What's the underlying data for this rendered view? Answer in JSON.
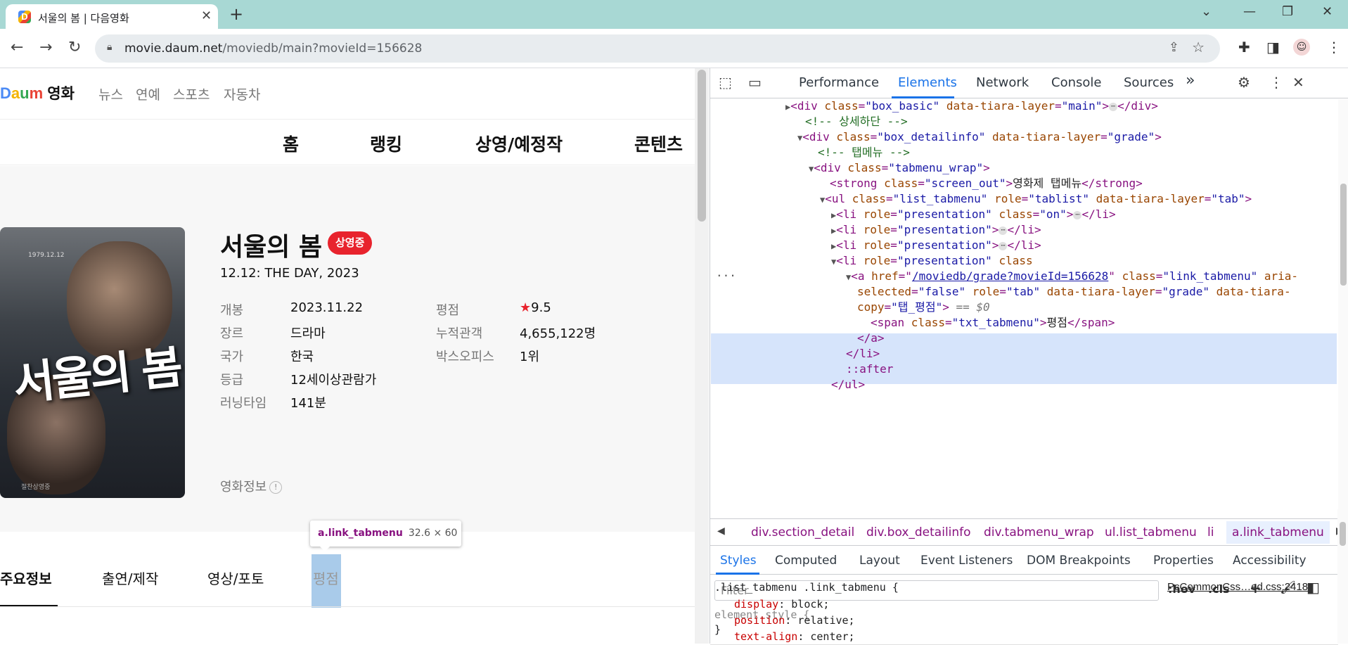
{
  "browser": {
    "tab_title": "서울의 봄 | 다음영화",
    "tab_favicon": "D",
    "url_host": "movie.daum.net",
    "url_path": "/moviedb/main?movieId=156628"
  },
  "site": {
    "logo": {
      "d": "D",
      "a": "a",
      "u": "u",
      "m": "m",
      "label": "영화"
    },
    "gnb": [
      "뉴스",
      "연예",
      "스포츠",
      "자동차"
    ],
    "lnb": [
      "홈",
      "랭킹",
      "상영/예정작",
      "콘텐츠"
    ]
  },
  "movie": {
    "title": "서울의 봄",
    "badge": "상영중",
    "subtitle": "12.12: THE DAY, 2023",
    "poster_title": "서울의 봄",
    "poster_top": "1979.12.12",
    "poster_bottom": "절찬상영중",
    "info_left": [
      {
        "label": "개봉",
        "value": "2023.11.22"
      },
      {
        "label": "장르",
        "value": "드라마"
      },
      {
        "label": "국가",
        "value": "한국"
      },
      {
        "label": "등급",
        "value": "12세이상관람가"
      },
      {
        "label": "러닝타임",
        "value": "141분"
      }
    ],
    "info_right": [
      {
        "label": "평점",
        "star": "★",
        "value": "9.5"
      },
      {
        "label": "누적관객",
        "value": "4,655,122명"
      },
      {
        "label": "박스오피스",
        "value": "1위"
      }
    ],
    "more_info": "영화정보",
    "more_info_icon": "!",
    "tabs": [
      "주요정보",
      "출연/제작",
      "영상/포토",
      "평점"
    ]
  },
  "inspect_tooltip": {
    "selector": "a.link_tabmenu",
    "size": "32.6 × 60"
  },
  "devtools": {
    "tabs": [
      "Performance",
      "Elements",
      "Network",
      "Console",
      "Sources"
    ],
    "more_tabs": "»",
    "dom": {
      "l1": {
        "tag_open": "<div ",
        "attr1": "class",
        "val1": "\"box_basic\"",
        "attr2": "data-tiara-layer",
        "val2": "\"main\"",
        "tag_close": "</div>"
      },
      "l2": "<!-- 상세하단 -->",
      "l3": {
        "tag_open": "<div ",
        "attr1": "class",
        "val1": "\"box_detailinfo\"",
        "attr2": "data-tiara-layer",
        "val2": "\"grade\""
      },
      "l4": "<!-- 탭메뉴 -->",
      "l5": {
        "tag_open": "<div ",
        "attr1": "class",
        "val1": "\"tabmenu_wrap\""
      },
      "l6": {
        "tag_open": "<strong ",
        "attr1": "class",
        "val1": "\"screen_out\"",
        "text": "영화제 탭메뉴",
        "tag_close": "</strong>"
      },
      "l7": {
        "tag_open": "<ul ",
        "attr1": "class",
        "val1": "\"list_tabmenu\"",
        "attr2": "role",
        "val2": "\"tablist\"",
        "attr3": "data-tiara-layer",
        "val3": "\"tab\""
      },
      "l8": {
        "tag_open": "<li ",
        "attr1": "role",
        "val1": "\"presentation\"",
        "attr2": "class",
        "val2": "\"on\"",
        "tag_close": "</li>"
      },
      "l9": {
        "tag_open": "<li ",
        "attr1": "role",
        "val1": "\"presentation\"",
        "tag_close": "</li>"
      },
      "l10": {
        "tag_open": "<li ",
        "attr1": "role",
        "val1": "\"presentation\"",
        "tag_close": "</li>"
      },
      "l11": {
        "tag_open": "<li ",
        "attr1": "role",
        "val1": "\"presentation\"",
        "attr2": "class"
      },
      "l12": {
        "tag_open": "<a ",
        "attr1": "href",
        "link": "/moviedb/grade?movieId=156628",
        "attr2": "class",
        "val2": "\"link_tabmenu\"",
        "attr3": "aria-"
      },
      "l13": {
        "cont": "selected",
        "val": "\"false\"",
        "attr2": "role",
        "val2": "\"tab\"",
        "attr3": "data-tiara-layer",
        "val3": "\"grade\"",
        "attr4": "data-tiara-"
      },
      "l14": {
        "cont": "copy",
        "val": "\"탭_평점\"",
        "eq": "== $0"
      },
      "l15": {
        "tag_open": "<span ",
        "attr1": "class",
        "val1": "\"txt_tabmenu\"",
        "text": "평점",
        "tag_close": "</span>"
      },
      "l16": "</a>",
      "l17": "</li>",
      "l18": "::after",
      "l19": "</ul>",
      "row_ellipsis": "...",
      "ellipsis": "⋯"
    },
    "breadcrumbs": [
      "div.section_detail",
      "div.box_detailinfo",
      "div.tabmenu_wrap",
      "ul.list_tabmenu",
      "li",
      "a.link_tabmenu"
    ],
    "subtabs": [
      "Styles",
      "Computed",
      "Layout",
      "Event Listeners",
      "DOM Breakpoints",
      "Properties",
      "Accessibility"
    ],
    "filter_placeholder": "Filter",
    "filter_buttons": [
      ":hov",
      ".cls"
    ],
    "styles": {
      "element_style": "element.style {",
      "close": "}",
      "rule_selector": ".list_tabmenu .link_tabmenu {",
      "source": "PcCommonCss…ed.css:2418",
      "props": [
        {
          "name": "display",
          "value": "block;"
        },
        {
          "name": "position",
          "value": "relative;"
        },
        {
          "name": "text-align",
          "value": "center;"
        }
      ]
    }
  }
}
